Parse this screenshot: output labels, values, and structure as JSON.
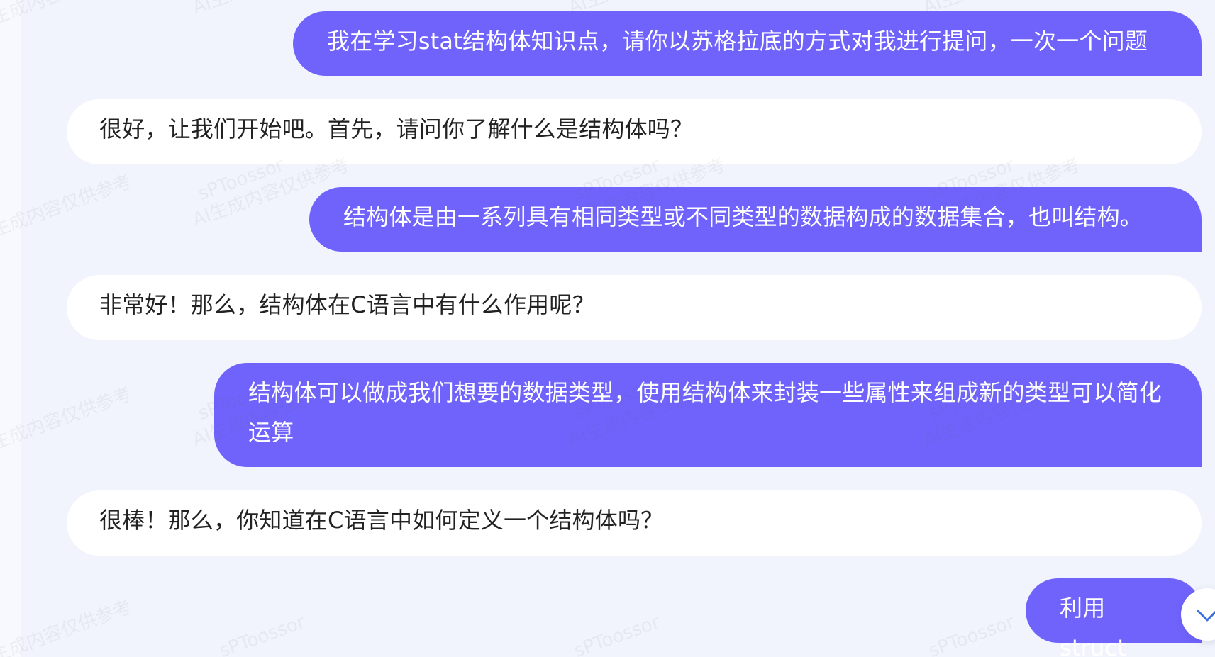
{
  "chat": {
    "messages": [
      {
        "role": "user",
        "text": "我在学习stat结构体知识点，请你以苏格拉底的方式对我进行提问，一次一个问题"
      },
      {
        "role": "assistant",
        "text": "很好，让我们开始吧。首先，请问你了解什么是结构体吗？"
      },
      {
        "role": "user",
        "text": "结构体是由一系列具有相同类型或不同类型的数据构成的数据集合，也叫结构。"
      },
      {
        "role": "assistant",
        "text": "非常好！那么，结构体在C语言中有什么作用呢？"
      },
      {
        "role": "user",
        "text": "结构体可以做成我们想要的数据类型，使用结构体来封装一些属性来组成新的类型可以简化运算"
      },
      {
        "role": "assistant",
        "text": "很棒！那么，你知道在C语言中如何定义一个结构体吗？"
      },
      {
        "role": "user",
        "text": "利用struct"
      }
    ]
  },
  "watermark": {
    "line1": "sPToossor",
    "line2": "AI生成内容仅供参考"
  },
  "scroll_button": {
    "icon": "chevron-down-icon"
  },
  "colors": {
    "user_bubble": "#6f63fc",
    "assistant_bubble": "#ffffff",
    "background": "#f1f4fc"
  }
}
